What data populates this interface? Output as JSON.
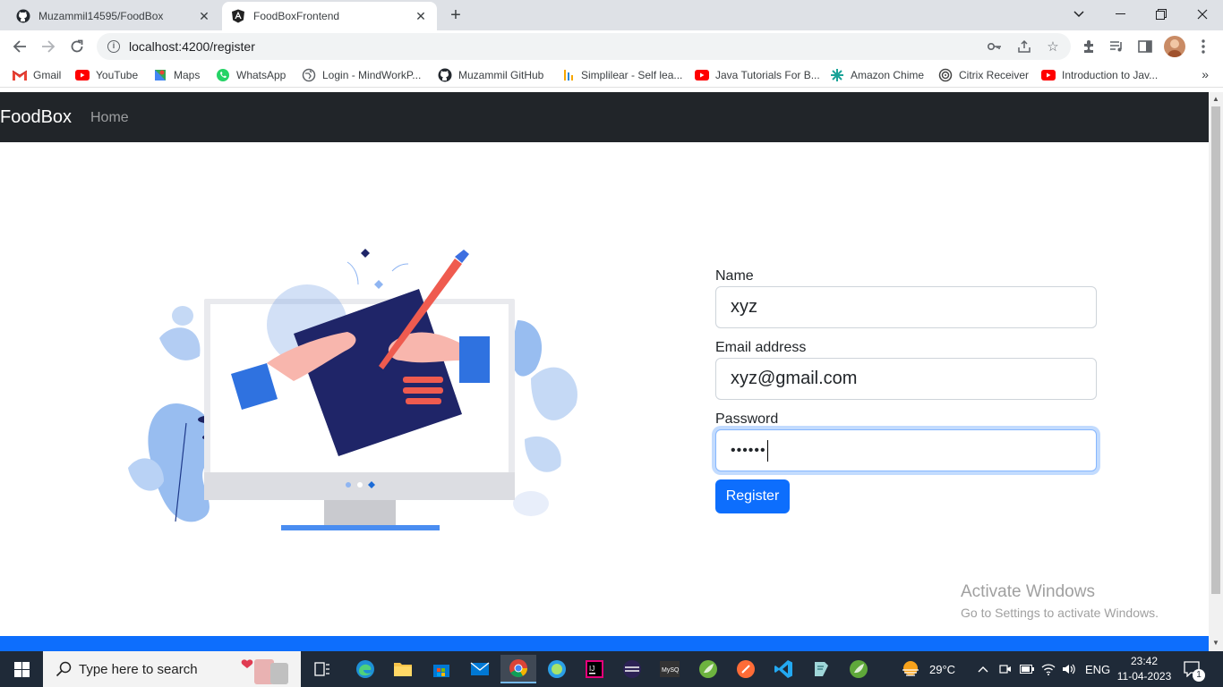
{
  "browser": {
    "tabs": [
      {
        "title": "Muzammil14595/FoodBox",
        "favicon": "github-icon",
        "active": false
      },
      {
        "title": "FoodBoxFrontend",
        "favicon": "angular-icon",
        "active": true
      }
    ],
    "new_tab": "+",
    "url": "localhost:4200/register",
    "bookmarks": [
      {
        "label": "Gmail",
        "icon": "gmail-icon"
      },
      {
        "label": "YouTube",
        "icon": "youtube-icon"
      },
      {
        "label": "Maps",
        "icon": "maps-icon"
      },
      {
        "label": "WhatsApp",
        "icon": "whatsapp-icon"
      },
      {
        "label": "Login - MindWorkP...",
        "icon": "globe-icon"
      },
      {
        "label": "Muzammil GitHub",
        "icon": "github-icon"
      },
      {
        "label": "Simplilear - Self lea...",
        "icon": "simplilearn-icon"
      },
      {
        "label": "Java Tutorials For B...",
        "icon": "youtube-icon"
      },
      {
        "label": "Amazon Chime",
        "icon": "chime-icon"
      },
      {
        "label": "Citrix Receiver",
        "icon": "citrix-icon"
      },
      {
        "label": "Introduction to Jav...",
        "icon": "youtube-icon"
      }
    ],
    "bookmarks_more": "»"
  },
  "app": {
    "brand": "FoodBox",
    "nav_home": "Home",
    "form": {
      "name_label": "Name",
      "name_value": "xyz",
      "email_label": "Email address",
      "email_value": "xyz@gmail.com",
      "password_label": "Password",
      "password_value": "••••••",
      "submit_label": "Register"
    }
  },
  "watermark": {
    "title": "Activate Windows",
    "subtitle": "Go to Settings to activate Windows."
  },
  "taskbar": {
    "search_placeholder": "Type here to search",
    "weather": "29°C",
    "language": "ENG",
    "time": "23:42",
    "date": "11-04-2023",
    "notification_count": "1"
  },
  "colors": {
    "navbar": "#212529",
    "primary": "#0d6efd",
    "taskbar": "#1f2a38"
  }
}
